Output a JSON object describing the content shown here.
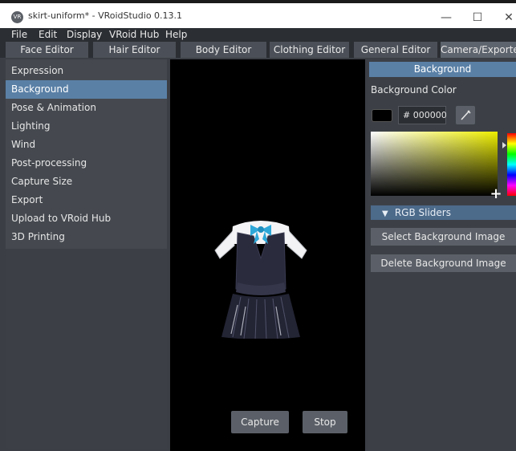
{
  "window": {
    "title": "skirt-uniform* - VRoidStudio 0.13.1",
    "app_icon": "VR",
    "minimize": "—",
    "maximize": "☐",
    "close": "✕"
  },
  "menu": [
    "File",
    "Edit",
    "Display",
    "VRoid Hub",
    "Help"
  ],
  "tabs": [
    "Face Editor",
    "Hair Editor",
    "Body Editor",
    "Clothing Editor",
    "General Editor",
    "Camera/Exporter"
  ],
  "active_tab": "Camera/Exporter",
  "sidebar": {
    "items": [
      "Expression",
      "Background",
      "Pose & Animation",
      "Lighting",
      "Wind",
      "Post-processing",
      "Capture Size",
      "Export",
      "Upload to VRoid Hub",
      "3D Printing"
    ],
    "selected": "Background"
  },
  "viewport": {
    "capture_label": "Capture",
    "stop_label": "Stop",
    "background_color": "#000000"
  },
  "panel": {
    "header": "Background",
    "color_label": "Background Color",
    "hex_prefix": "#",
    "hex_value": "000000",
    "rgb_toggle": "RGB Sliders",
    "select_image": "Select Background Image",
    "delete_image": "Delete Background Image",
    "picker_icon": "eyedropper-icon",
    "hue_marker_color": "#ffff00"
  },
  "colors": {
    "accent": "#5a80a6",
    "panel": "#3c4046",
    "button": "#5b6068"
  }
}
